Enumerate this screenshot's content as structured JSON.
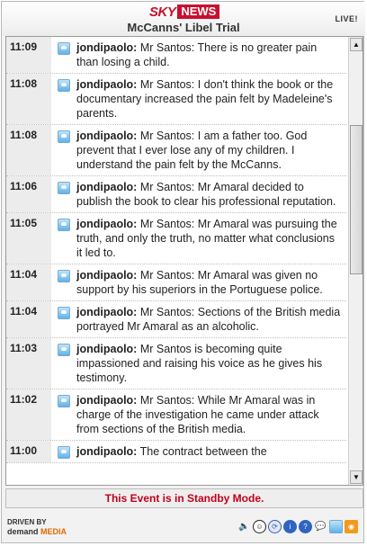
{
  "header": {
    "logo_sky": "SKY",
    "logo_news": "NEWS",
    "title": "McCanns' Libel Trial",
    "live": "LIVE!"
  },
  "feed": {
    "items": [
      {
        "time": "11:09",
        "user": "jondipaolo:",
        "text": " Mr Santos: There is no greater pain than losing a child."
      },
      {
        "time": "11:08",
        "user": "jondipaolo:",
        "text": " Mr Santos: I don't think the book or the documentary increased the pain felt by Madeleine's parents."
      },
      {
        "time": "11:08",
        "user": "jondipaolo:",
        "text": " Mr Santos: I am a father too. God prevent that I ever lose any of my children. I understand the pain felt by the McCanns."
      },
      {
        "time": "11:06",
        "user": "jondipaolo:",
        "text": " Mr Santos: Mr Amaral decided to publish the book to clear his professional reputation."
      },
      {
        "time": "11:05",
        "user": "jondipaolo:",
        "text": " Mr Santos: Mr Amaral was pursuing the truth, and only the truth, no matter what conclusions it led to."
      },
      {
        "time": "11:04",
        "user": "jondipaolo:",
        "text": " Mr Santos: Mr Amaral was given no support by his superiors in the Portuguese police."
      },
      {
        "time": "11:04",
        "user": "jondipaolo:",
        "text": " Mr Santos: Sections of the British media portrayed Mr Amaral as an alcoholic."
      },
      {
        "time": "11:03",
        "user": "jondipaolo:",
        "text": " Mr Santos is becoming quite impassioned and raising his voice as he gives his testimony."
      },
      {
        "time": "11:02",
        "user": "jondipaolo:",
        "text": " Mr Santos: While Mr Amaral was in charge of the investigation he came under attack from sections of the British media."
      },
      {
        "time": "11:00",
        "user": "jondipaolo:",
        "text": " The contract between the"
      }
    ]
  },
  "status": {
    "standby": "This Event is in Standby Mode."
  },
  "footer": {
    "driven_by": "DRIVEN BY",
    "brand_a": "demand",
    "brand_b": "MEDIA",
    "icons": [
      "speaker-icon",
      "smiley-icon",
      "refresh-icon",
      "info-icon",
      "help-icon",
      "chat-icon",
      "twitter-icon",
      "rss-icon"
    ]
  },
  "colors": {
    "accent_red": "#c8102e",
    "standby_red": "#c0001a",
    "twitter_blue": "#5fb2ea"
  }
}
